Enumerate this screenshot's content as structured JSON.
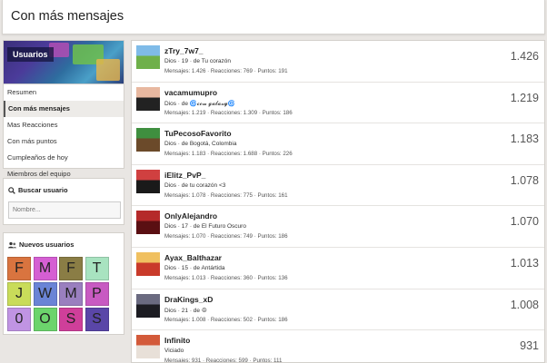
{
  "page": {
    "title": "Con más mensajes"
  },
  "sidebar": {
    "nav_title": "Usuarios",
    "nav_items": [
      "Resumen",
      "Con más mensajes",
      "Mas Reacciones",
      "Con más puntos",
      "Cumpleaños de hoy",
      "Miembros del equipo"
    ],
    "active_index": 1,
    "search": {
      "title": "Buscar usuario",
      "placeholder": "Nombre..."
    },
    "new_users": {
      "title": "Nuevos usuarios",
      "tiles": [
        {
          "letter": "F",
          "color": "#d9743f"
        },
        {
          "letter": "M",
          "color": "#d55fd3"
        },
        {
          "letter": "F",
          "color": "#8a7d45"
        },
        {
          "letter": "T",
          "color": "#a8e3c0"
        },
        {
          "letter": "J",
          "color": "#c9dc5a"
        },
        {
          "letter": "W",
          "color": "#6a84d6"
        },
        {
          "letter": "M",
          "color": "#9a7fbf"
        },
        {
          "letter": "P",
          "color": "#c85ac2"
        },
        {
          "letter": "0",
          "color": "#c094e3"
        },
        {
          "letter": "O",
          "color": "#6cd46c"
        },
        {
          "letter": "S",
          "color": "#cf3f9a"
        },
        {
          "letter": "S",
          "color": "#5a46a8"
        }
      ]
    }
  },
  "members": [
    {
      "name": "zTry_7w7_",
      "line1": "Dios · 19 · de Tu corazón",
      "line2": "Mensajes: 1.426 · Reacciones: 769 · Puntos: 191",
      "count": "1.426",
      "avatar_color": "#6fb04a",
      "avatar_color2": "#7fbbe8"
    },
    {
      "name": "vacamumupro",
      "line1": "Dios · de 🌀𝓬𝓸𝔀 𝓰𝓪𝓵𝓪𝔁𝔂🌀",
      "line2": "Mensajes: 1.219 · Reacciones: 1.309 · Puntos: 186",
      "count": "1.219",
      "avatar_color": "#222222",
      "avatar_color2": "#e8b8a0"
    },
    {
      "name": "TuPecosoFavorito",
      "line1": "Dios · de Bogotá, Colombia",
      "line2": "Mensajes: 1.183 · Reacciones: 1.688 · Puntos: 226",
      "count": "1.183",
      "avatar_color": "#6b4a2a",
      "avatar_color2": "#3f8f3f"
    },
    {
      "name": "iElitz_PvP_",
      "line1": "Dios · de tu corazón <3",
      "line2": "Mensajes: 1.078 · Reacciones: 775 · Puntos: 161",
      "count": "1.078",
      "avatar_color": "#1a1a1a",
      "avatar_color2": "#d04040"
    },
    {
      "name": "OnlyAlejandro",
      "line1": "Dios · 17 · de El Futuro Oscuro",
      "line2": "Mensajes: 1.070 · Reacciones: 749 · Puntos: 186",
      "count": "1.070",
      "avatar_color": "#5a0f12",
      "avatar_color2": "#b52a2a"
    },
    {
      "name": "Ayax_Balthazar",
      "line1": "Dios · 15 · de Antártida",
      "line2": "Mensajes: 1.013 · Reacciones: 360 · Puntos: 136",
      "count": "1.013",
      "avatar_color": "#c93a2a",
      "avatar_color2": "#f0c060"
    },
    {
      "name": "DraKings_xD",
      "line1": "Dios · 21 · de ☮",
      "line2": "Mensajes: 1.008 · Reacciones: 502 · Puntos: 186",
      "count": "1.008",
      "avatar_color": "#1c1c22",
      "avatar_color2": "#6a6a80"
    },
    {
      "name": "Infinito",
      "line1": "Viciado",
      "line2": "Mensajes: 931 · Reacciones: 599 · Puntos: 111",
      "count": "931",
      "avatar_color": "#e8e0d8",
      "avatar_color2": "#d35a3a"
    }
  ]
}
